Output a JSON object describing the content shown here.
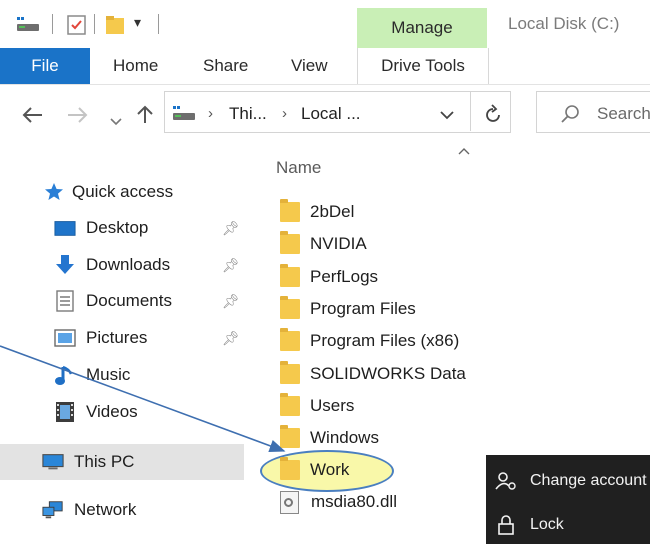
{
  "titlebar": {
    "manage_label": "Manage",
    "window_title": "Local Disk (C:)",
    "qa_icons": [
      "drive-icon",
      "properties-icon",
      "new-folder-icon",
      "customize-dropdown-icon"
    ]
  },
  "ribbon": {
    "tabs": [
      {
        "label": "File"
      },
      {
        "label": "Home"
      },
      {
        "label": "Share"
      },
      {
        "label": "View"
      },
      {
        "label": "Drive Tools"
      }
    ]
  },
  "address": {
    "breadcrumbs": [
      "Thi...",
      "Local ..."
    ],
    "search_placeholder": "Search"
  },
  "nav_pane": {
    "quick_access": "Quick access",
    "items": [
      {
        "label": "Desktop",
        "pinned": true
      },
      {
        "label": "Downloads",
        "pinned": true
      },
      {
        "label": "Documents",
        "pinned": true
      },
      {
        "label": "Pictures",
        "pinned": true
      },
      {
        "label": "Music",
        "pinned": false
      },
      {
        "label": "Videos",
        "pinned": false
      }
    ],
    "this_pc": "This PC",
    "network": "Network"
  },
  "file_list": {
    "column_header": "Name",
    "items": [
      {
        "name": "2bDel",
        "type": "folder"
      },
      {
        "name": "NVIDIA",
        "type": "folder"
      },
      {
        "name": "PerfLogs",
        "type": "folder"
      },
      {
        "name": "Program Files",
        "type": "folder"
      },
      {
        "name": "Program Files (x86)",
        "type": "folder"
      },
      {
        "name": "SOLIDWORKS Data",
        "type": "folder"
      },
      {
        "name": "Users",
        "type": "folder"
      },
      {
        "name": "Windows",
        "type": "folder"
      },
      {
        "name": "Work",
        "type": "folder",
        "highlighted": true
      },
      {
        "name": "msdia80.dll",
        "type": "file"
      }
    ]
  },
  "account_menu": {
    "items": [
      {
        "label": "Change account",
        "icon": "change-account-icon"
      },
      {
        "label": "Lock",
        "icon": "lock-icon"
      }
    ]
  },
  "colors": {
    "file_tab": "#1a73c8",
    "manage_tab": "#c9efb6",
    "folder": "#f5c94c",
    "highlight_fill": "#f8f696",
    "highlight_stroke": "#4a7fc0",
    "flyout_bg": "#202020"
  }
}
